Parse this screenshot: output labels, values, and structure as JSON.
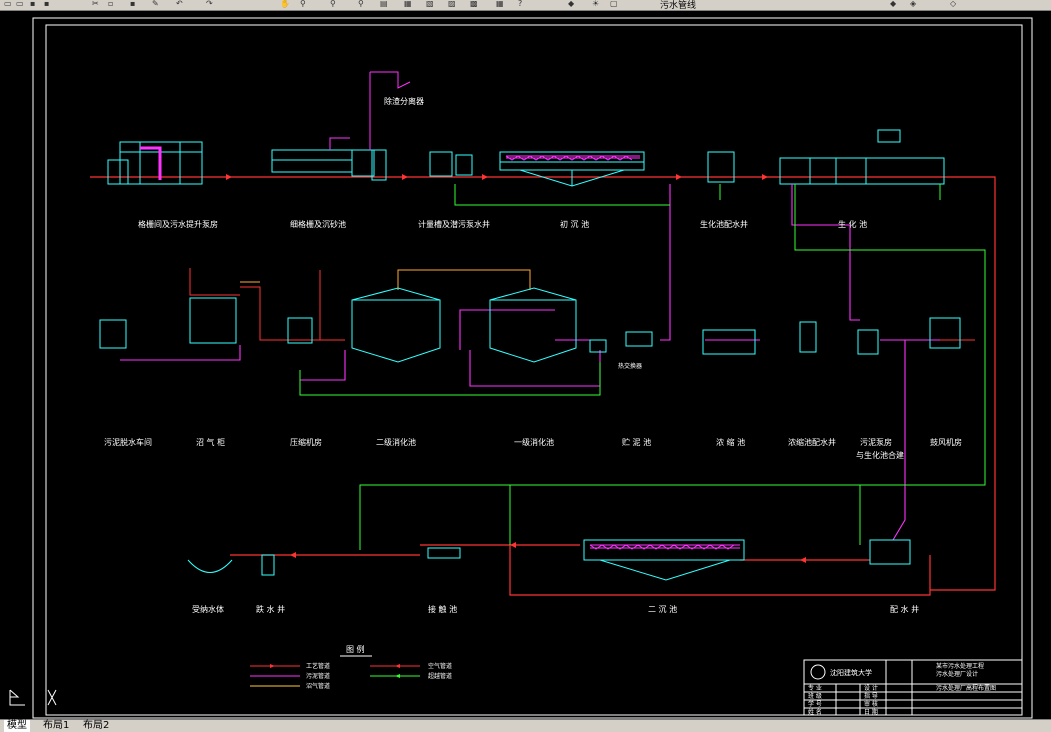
{
  "toolbar": {
    "layer_label": "污水管线"
  },
  "drawing": {
    "top_row": {
      "labels": [
        "格栅间及污水提升泵房",
        "细格栅及沉砂池",
        "计量槽及潜污泵水井",
        "初 沉 池",
        "生化池配水井",
        "生 化 池"
      ],
      "sludge_label": "除渣分离器"
    },
    "mid_row": {
      "labels": [
        "污泥脱水车间",
        "沼 气 柜",
        "压缩机房",
        "二级消化池",
        "一级消化池",
        "贮 泥 池",
        "浓 缩 池",
        "浓缩池配水井",
        "污泥泵房",
        "鼓风机房"
      ],
      "sub_label": "与生化池合建",
      "note_small": "热交换器"
    },
    "bottom_row": {
      "labels": [
        "受纳水体",
        "跌 水 井",
        "接 触 池",
        "二 沉 池",
        "配 水 井"
      ]
    },
    "legend": {
      "title": "图 例",
      "items": [
        "工艺管道",
        "污泥管道",
        "沼气管道",
        "空气管道",
        "超越管道"
      ]
    },
    "title_block": {
      "school": "沈阳建筑大学",
      "project": "某市污水处理工程",
      "subtitle": "污水处理厂设计",
      "drawing_name": "污水处理厂高程布置图",
      "row_labels": [
        "专 业",
        "班 级",
        "学 号",
        "姓 名"
      ],
      "col_labels": [
        "设 计",
        "指 导",
        "审 核",
        "日 期"
      ]
    }
  },
  "tabs": [
    {
      "label": "模型",
      "active": true
    },
    {
      "label": "布局1",
      "active": false
    },
    {
      "label": "布局2",
      "active": false
    }
  ],
  "colors": {
    "process": "#ff3333",
    "sludge": "#ff33ff",
    "biogas": "#ffcc33",
    "air": "#33ff33",
    "structure": "#33ffff",
    "text": "#ffffff"
  }
}
